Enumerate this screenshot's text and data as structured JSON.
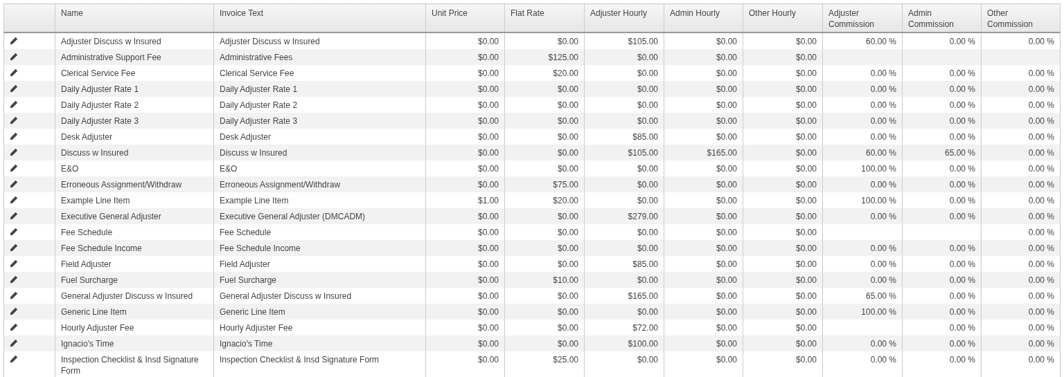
{
  "table": {
    "columns": [
      "Name",
      "Invoice Text",
      "Unit Price",
      "Flat Rate",
      "Adjuster Hourly",
      "Admin Hourly",
      "Other Hourly",
      "Adjuster Commission",
      "Admin Commission",
      "Other Commission"
    ],
    "rows": [
      [
        "Adjuster Discuss w Insured",
        "Adjuster Discuss w Insured",
        "$0.00",
        "$0.00",
        "$105.00",
        "$0.00",
        "$0.00",
        "60.00 %",
        "0.00 %",
        "0.00 %"
      ],
      [
        "Administrative Support Fee",
        "Administrative Fees",
        "$0.00",
        "$125.00",
        "$0.00",
        "$0.00",
        "$0.00",
        null,
        null,
        null
      ],
      [
        "Clerical Service Fee",
        "Clerical Service Fee",
        "$0.00",
        "$20.00",
        "$0.00",
        "$0.00",
        "$0.00",
        "0.00 %",
        "0.00 %",
        "0.00 %"
      ],
      [
        "Daily Adjuster Rate 1",
        "Daily Adjuster Rate 1",
        "$0.00",
        "$0.00",
        "$0.00",
        "$0.00",
        "$0.00",
        "0.00 %",
        "0.00 %",
        "0.00 %"
      ],
      [
        "Daily Adjuster Rate 2",
        "Daily Adjuster Rate 2",
        "$0.00",
        "$0.00",
        "$0.00",
        "$0.00",
        "$0.00",
        "0.00 %",
        "0.00 %",
        "0.00 %"
      ],
      [
        "Daily Adjuster Rate 3",
        "Daily Adjuster Rate 3",
        "$0.00",
        "$0.00",
        "$0.00",
        "$0.00",
        "$0.00",
        "0.00 %",
        "0.00 %",
        "0.00 %"
      ],
      [
        "Desk Adjuster",
        "Desk Adjuster",
        "$0.00",
        "$0.00",
        "$85.00",
        "$0.00",
        "$0.00",
        "0.00 %",
        "0.00 %",
        "0.00 %"
      ],
      [
        "Discuss w Insured",
        "Discuss w Insured",
        "$0.00",
        "$0.00",
        "$105.00",
        "$165.00",
        "$0.00",
        "60.00 %",
        "65.00 %",
        "0.00 %"
      ],
      [
        "E&O",
        "E&O",
        "$0.00",
        "$0.00",
        "$0.00",
        "$0.00",
        "$0.00",
        "100.00 %",
        "0.00 %",
        "0.00 %"
      ],
      [
        "Erroneous Assignment/Withdraw",
        "Erroneous Assignment/Withdraw",
        "$0.00",
        "$75.00",
        "$0.00",
        "$0.00",
        "$0.00",
        "0.00 %",
        "0.00 %",
        "0.00 %"
      ],
      [
        "Example Line Item",
        "Example Line Item",
        "$1.00",
        "$20.00",
        "$0.00",
        "$0.00",
        "$0.00",
        "100.00 %",
        "0.00 %",
        "0.00 %"
      ],
      [
        "Executive General Adjuster",
        "Executive General Adjuster (DMCADM)",
        "$0.00",
        "$0.00",
        "$279.00",
        "$0.00",
        "$0.00",
        "0.00 %",
        "0.00 %",
        "0.00 %"
      ],
      [
        "Fee Schedule",
        "Fee Schedule",
        "$0.00",
        "$0.00",
        "$0.00",
        "$0.00",
        "$0.00",
        null,
        null,
        "0.00 %"
      ],
      [
        "Fee Schedule Income",
        "Fee Schedule Income",
        "$0.00",
        "$0.00",
        "$0.00",
        "$0.00",
        "$0.00",
        "0.00 %",
        "0.00 %",
        "0.00 %"
      ],
      [
        "Field Adjuster",
        "Field Adjuster",
        "$0.00",
        "$0.00",
        "$85.00",
        "$0.00",
        "$0.00",
        "0.00 %",
        "0.00 %",
        "0.00 %"
      ],
      [
        "Fuel Surcharge",
        "Fuel Surcharge",
        "$0.00",
        "$10.00",
        "$0.00",
        "$0.00",
        "$0.00",
        "0.00 %",
        "0.00 %",
        "0.00 %"
      ],
      [
        "General Adjuster Discuss w Insured",
        "General Adjuster Discuss w Insured",
        "$0.00",
        "$0.00",
        "$165.00",
        "$0.00",
        "$0.00",
        "65.00 %",
        "0.00 %",
        "0.00 %"
      ],
      [
        "Generic Line Item",
        "Generic Line Item",
        "$0.00",
        "$0.00",
        "$0.00",
        "$0.00",
        "$0.00",
        "100.00 %",
        "0.00 %",
        "0.00 %"
      ],
      [
        "Hourly Adjuster Fee",
        "Hourly Adjuster Fee",
        "$0.00",
        "$0.00",
        "$72.00",
        "$0.00",
        "$0.00",
        null,
        "0.00 %",
        "0.00 %"
      ],
      [
        "Ignacio's Time",
        "Ignacio's Time",
        "$0.00",
        "$0.00",
        "$100.00",
        "$0.00",
        "$0.00",
        "0.00 %",
        "0.00 %",
        "0.00 %"
      ],
      [
        "Inspection Checklist & Insd Signature Form",
        "Inspection Checklist & Insd Signature Form",
        "$0.00",
        "$25.00",
        "$0.00",
        "$0.00",
        "$0.00",
        "0.00 %",
        "0.00 %",
        "0.00 %"
      ]
    ]
  }
}
